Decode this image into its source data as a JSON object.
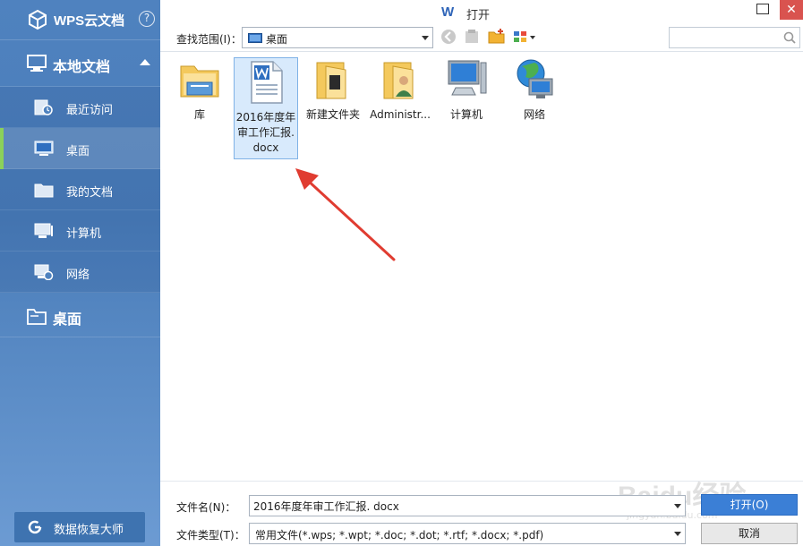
{
  "sidebar": {
    "brand": "WPS云文档",
    "help": "?",
    "local_docs": "本地文档",
    "items": [
      {
        "label": "最近访问",
        "icon": "recent-clock-icon"
      },
      {
        "label": "桌面",
        "icon": "desktop-monitor-icon",
        "active": true
      },
      {
        "label": "我的文档",
        "icon": "folder-icon"
      },
      {
        "label": "计算机",
        "icon": "computer-icon"
      },
      {
        "label": "网络",
        "icon": "network-icon"
      }
    ],
    "desktop_section": "桌面",
    "recover_button": "数据恢复大师"
  },
  "titlebar": {
    "app_letter": "W",
    "title": "打开",
    "close": "✕"
  },
  "toolbar": {
    "look_in_label": "查找范围(I)：",
    "look_in_value": "桌面",
    "search_placeholder": ""
  },
  "files": [
    {
      "label": "库",
      "icon": "library-folder-icon"
    },
    {
      "label": "2016年度年审工作汇报.docx",
      "icon": "word-document-icon",
      "selected": true
    },
    {
      "label": "新建文件夹",
      "icon": "folder-icon"
    },
    {
      "label": "Administr...",
      "icon": "user-folder-icon"
    },
    {
      "label": "计算机",
      "icon": "computer-icon"
    },
    {
      "label": "网络",
      "icon": "network-globe-icon"
    }
  ],
  "bottom": {
    "filename_label": "文件名(N)：",
    "filename_value": "2016年度年审工作汇报. docx",
    "filetype_label": "文件类型(T)：",
    "filetype_value": "常用文件(*.wps; *.wpt; *.doc; *.dot; *.rtf; *.docx; *.pdf)",
    "open_button": "打开(O)",
    "cancel_button": "取消"
  },
  "watermark": {
    "main": "Baidu经验",
    "sub": "jingyan.baidu.com"
  },
  "colors": {
    "sidebar": "#4f82bf",
    "accent_active": "#8bd15a",
    "open_button": "#3b7fd6",
    "annotation_arrow": "#e03c31"
  }
}
